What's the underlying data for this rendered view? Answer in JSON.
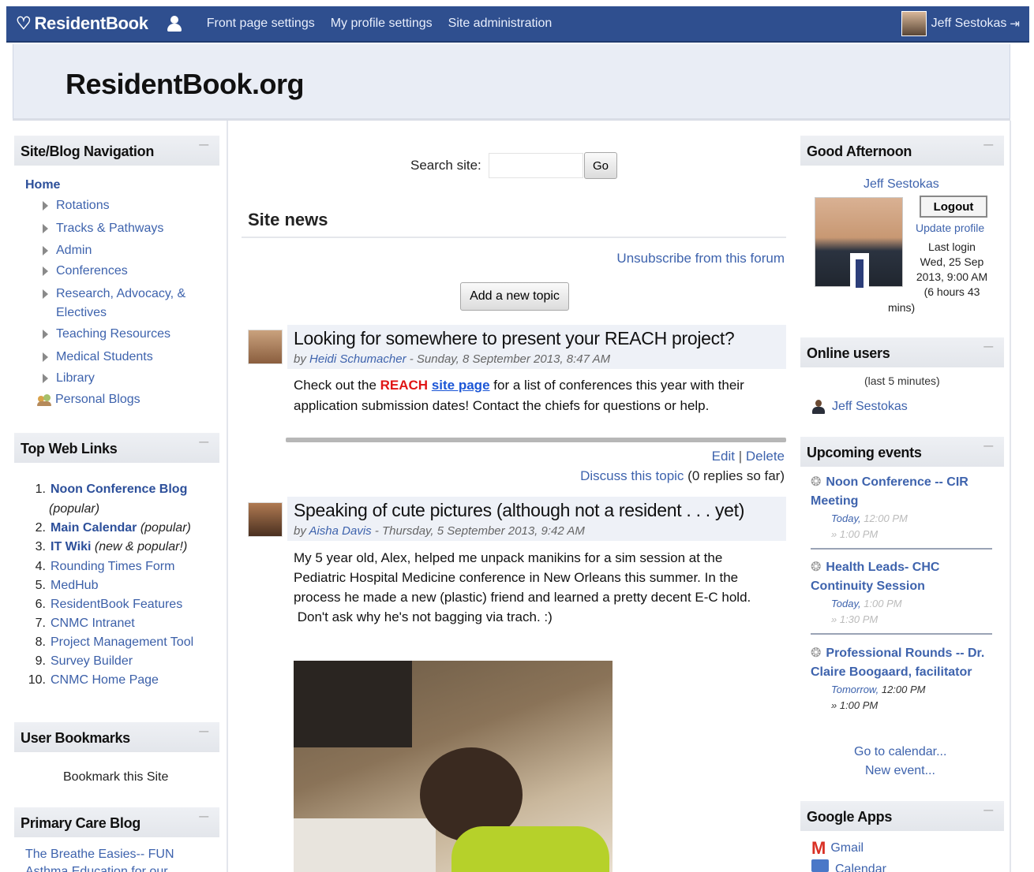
{
  "topbar": {
    "brand": "ResidentBook",
    "nav": [
      "Front page settings",
      "My profile settings",
      "Site administration"
    ],
    "user": "Jeff Sestokas"
  },
  "header": {
    "site_title": "ResidentBook.org"
  },
  "left": {
    "nav_block": {
      "title": "Site/Blog Navigation",
      "home": "Home",
      "items": [
        "Rotations",
        "Tracks & Pathways",
        "Admin",
        "Conferences",
        "Research, Advocacy, &",
        "Electives",
        "Teaching Resources",
        "Medical Students",
        "Library"
      ],
      "personal_blogs": "Personal Blogs"
    },
    "web_links": {
      "title": "Top Web Links",
      "items": [
        {
          "num": "1.",
          "label": "Noon Conference Blog",
          "note": "(popular)"
        },
        {
          "num": "2.",
          "label": "Main Calendar",
          "note": "(popular)"
        },
        {
          "num": "3.",
          "label": "IT Wiki",
          "note": "(new & popular!)"
        },
        {
          "num": "4.",
          "label": "Rounding Times Form",
          "note": ""
        },
        {
          "num": "5.",
          "label": "MedHub",
          "note": ""
        },
        {
          "num": "6.",
          "label": "ResidentBook Features",
          "note": ""
        },
        {
          "num": "7.",
          "label": "CNMC Intranet",
          "note": ""
        },
        {
          "num": "8.",
          "label": "Project Management Tool",
          "note": ""
        },
        {
          "num": "9.",
          "label": "Survey Builder",
          "note": ""
        },
        {
          "num": "10.",
          "label": "CNMC Home Page",
          "note": ""
        }
      ]
    },
    "bookmarks": {
      "title": "User Bookmarks",
      "bookmark_site": "Bookmark this Site"
    },
    "primary_care": {
      "title": "Primary Care Blog",
      "line1": "The Breathe Easies-- FUN",
      "line2": "Asthma Education for our"
    }
  },
  "center": {
    "search_label": "Search site:",
    "search_value": "",
    "go": "Go",
    "site_news": "Site news",
    "unsubscribe": "Unsubscribe from this forum",
    "add_topic": "Add a new topic",
    "posts": [
      {
        "title": "Looking for somewhere to present your REACH project?",
        "by": "by",
        "author": "Heidi Schumacher",
        "date": "- Sunday, 8 September 2013, 8:47 AM",
        "body_pre": "Check out the",
        "reach": "REACH",
        "site_page": "site page",
        "body_post": "for a list of conferences this year with their",
        "body_line2": "application submission dates!  Contact the chiefs for questions or help.",
        "edit": "Edit",
        "sep": "|",
        "delete": "Delete",
        "discuss": "Discuss this topic",
        "replies": "(0 replies so far)"
      },
      {
        "title": "Speaking of cute pictures (although not a resident . . . yet)",
        "by": "by",
        "author": "Aisha Davis",
        "date": "- Thursday, 5 September 2013, 9:42 AM",
        "lines": [
          "My 5 year old, Alex, helped me unpack manikins for a sim session at the",
          "Pediatric Hospital Medicine conference in New Orleans this summer.  In the",
          "process he made a new (plastic) friend and learned a pretty decent E-C hold.",
          " Don't ask why he's not bagging via trach. :)"
        ]
      }
    ]
  },
  "right": {
    "greeting": {
      "title": "Good Afternoon",
      "name": "Jeff Sestokas",
      "logout": "Logout",
      "update_profile": "Update profile",
      "last_login": [
        "Last login",
        "Wed, 25 Sep",
        "2013, 9:00 AM",
        "(6 hours 43"
      ],
      "mins": "mins)"
    },
    "online": {
      "title": "Online users",
      "subtitle": "(last 5 minutes)",
      "user": "Jeff Sestokas"
    },
    "events": {
      "title": "Upcoming events",
      "items": [
        {
          "title": "Noon Conference -- CIR Meeting",
          "day": "Today,",
          "start": "12:00 PM",
          "end": "» 1:00 PM"
        },
        {
          "title": "Health Leads- CHC Continuity Session",
          "day": "Today,",
          "start": "1:00 PM",
          "end": "» 1:30 PM"
        },
        {
          "title": "Professional Rounds -- Dr. Claire Boogaard, facilitator",
          "day": "Tomorrow,",
          "start": "12:00 PM",
          "end": "» 1:00 PM"
        }
      ],
      "goto_calendar": "Go to calendar...",
      "new_event": "New event..."
    },
    "google_apps": {
      "title": "Google Apps",
      "gmail": "Gmail",
      "calendar": "Calendar"
    }
  }
}
